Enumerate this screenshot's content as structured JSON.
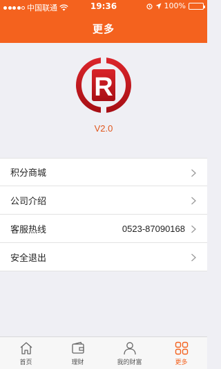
{
  "status_bar": {
    "carrier": "中国联通",
    "time": "19:36",
    "battery": "100%"
  },
  "header": {
    "title": "更多"
  },
  "app": {
    "version": "V2.0",
    "logo_letter": "R"
  },
  "menu": {
    "items": [
      {
        "label": "积分商城",
        "value": ""
      },
      {
        "label": "公司介绍",
        "value": ""
      },
      {
        "label": "客服热线",
        "value": "0523-87090168"
      },
      {
        "label": "安全退出",
        "value": ""
      }
    ]
  },
  "tabbar": {
    "tabs": [
      {
        "label": "首页",
        "icon": "home-icon"
      },
      {
        "label": "理财",
        "icon": "wallet-icon"
      },
      {
        "label": "我的财富",
        "icon": "user-icon"
      },
      {
        "label": "更多",
        "icon": "grid-icon"
      }
    ],
    "active": "更多"
  },
  "colors": {
    "accent": "#f4621e",
    "logo_red": "#c8181e",
    "background": "#efeff4"
  }
}
